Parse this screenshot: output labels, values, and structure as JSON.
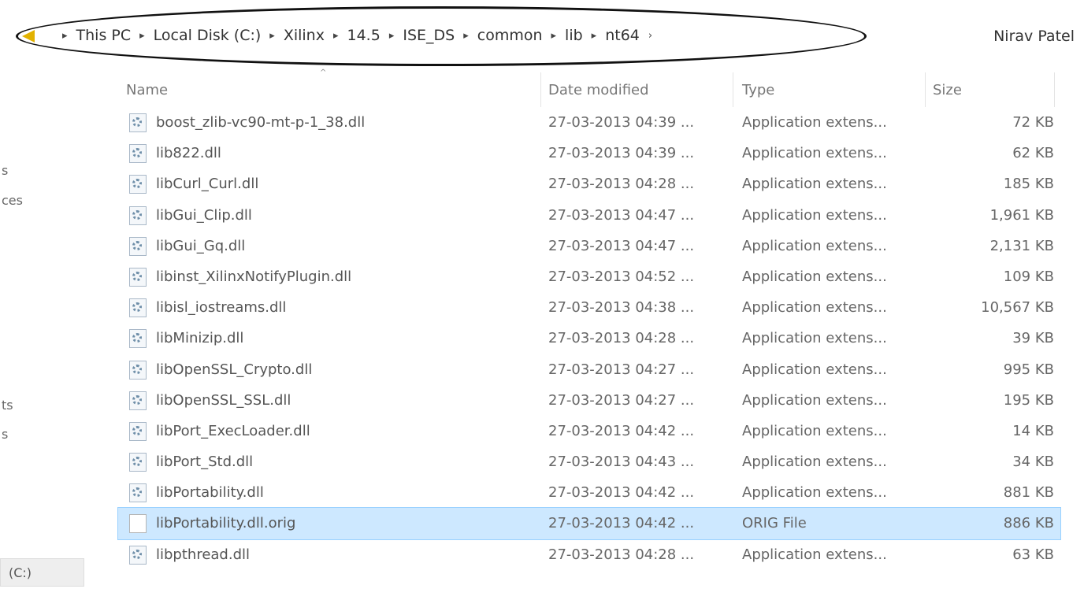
{
  "breadcrumb": {
    "items": [
      "This PC",
      "Local Disk (C:)",
      "Xilinx",
      "14.5",
      "ISE_DS",
      "common",
      "lib",
      "nt64"
    ],
    "separator": "▸",
    "trailing_separator": "›"
  },
  "user": {
    "name": "Nirav Patel"
  },
  "nav_pane": {
    "fragments": [
      "s",
      "ces",
      "ts",
      "s"
    ],
    "drive_label": "(C:)"
  },
  "columns": {
    "name": "Name",
    "date": "Date modified",
    "type": "Type",
    "size": "Size",
    "sort_indicator": "^"
  },
  "files": [
    {
      "name": "boost_zlib-vc90-mt-p-1_38.dll",
      "date": "27-03-2013 04:39 ...",
      "type": "Application extens...",
      "size": "72 KB",
      "icon": "dll-gear-icon"
    },
    {
      "name": "lib822.dll",
      "date": "27-03-2013 04:39 ...",
      "type": "Application extens...",
      "size": "62 KB",
      "icon": "dll-gear-icon"
    },
    {
      "name": "libCurl_Curl.dll",
      "date": "27-03-2013 04:28 ...",
      "type": "Application extens...",
      "size": "185 KB",
      "icon": "dll-gear-icon"
    },
    {
      "name": "libGui_Clip.dll",
      "date": "27-03-2013 04:47 ...",
      "type": "Application extens...",
      "size": "1,961 KB",
      "icon": "dll-gear-icon"
    },
    {
      "name": "libGui_Gq.dll",
      "date": "27-03-2013 04:47 ...",
      "type": "Application extens...",
      "size": "2,131 KB",
      "icon": "dll-gear-icon"
    },
    {
      "name": "libinst_XilinxNotifyPlugin.dll",
      "date": "27-03-2013 04:52 ...",
      "type": "Application extens...",
      "size": "109 KB",
      "icon": "dll-gear-icon"
    },
    {
      "name": "libisl_iostreams.dll",
      "date": "27-03-2013 04:38 ...",
      "type": "Application extens...",
      "size": "10,567 KB",
      "icon": "dll-gear-icon"
    },
    {
      "name": "libMinizip.dll",
      "date": "27-03-2013 04:28 ...",
      "type": "Application extens...",
      "size": "39 KB",
      "icon": "dll-gear-icon"
    },
    {
      "name": "libOpenSSL_Crypto.dll",
      "date": "27-03-2013 04:27 ...",
      "type": "Application extens...",
      "size": "995 KB",
      "icon": "dll-gear-icon"
    },
    {
      "name": "libOpenSSL_SSL.dll",
      "date": "27-03-2013 04:27 ...",
      "type": "Application extens...",
      "size": "195 KB",
      "icon": "dll-gear-icon"
    },
    {
      "name": "libPort_ExecLoader.dll",
      "date": "27-03-2013 04:42 ...",
      "type": "Application extens...",
      "size": "14 KB",
      "icon": "dll-gear-icon"
    },
    {
      "name": "libPort_Std.dll",
      "date": "27-03-2013 04:43 ...",
      "type": "Application extens...",
      "size": "34 KB",
      "icon": "dll-gear-icon"
    },
    {
      "name": "libPortability.dll",
      "date": "27-03-2013 04:42 ...",
      "type": "Application extens...",
      "size": "881 KB",
      "icon": "dll-gear-icon"
    },
    {
      "name": "libPortability.dll.orig",
      "date": "27-03-2013 04:42 ...",
      "type": "ORIG File",
      "size": "886 KB",
      "icon": "blank-file-icon",
      "selected": true
    },
    {
      "name": "libpthread.dll",
      "date": "27-03-2013 04:28 ...",
      "type": "Application extens...",
      "size": "63 KB",
      "icon": "dll-gear-icon"
    }
  ],
  "colors": {
    "selection_bg": "#cde8ff",
    "selection_border": "#99d1ff",
    "annotation_ellipse": "#111111",
    "back_arrow": "#e2b200"
  }
}
